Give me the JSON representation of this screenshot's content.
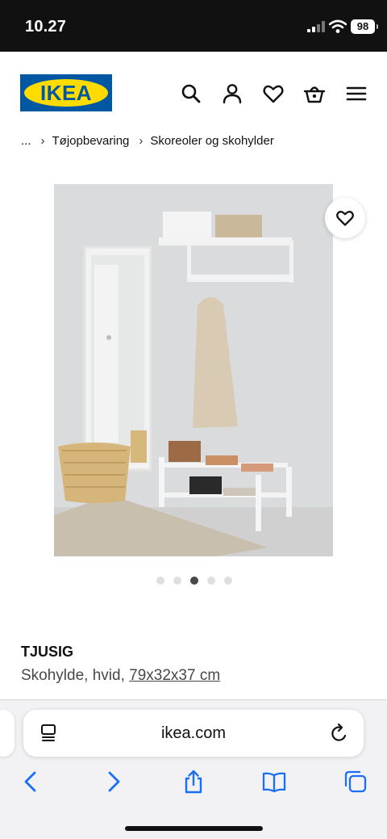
{
  "status_bar": {
    "time": "10.27",
    "battery": "98",
    "signal_icon": "cellular-signal-icon",
    "wifi_icon": "wifi-icon"
  },
  "header": {
    "logo_text": "IKEA",
    "colors": {
      "brand_blue": "#0058a3",
      "brand_yellow": "#ffdb00"
    },
    "icons": [
      "search-icon",
      "user-icon",
      "heart-icon",
      "basket-icon",
      "menu-icon"
    ]
  },
  "breadcrumb": {
    "ellipsis": "...",
    "items": [
      "Tøjopbevaring",
      "Skoreoler og skohylder"
    ]
  },
  "gallery": {
    "image_count": 5,
    "active_index": 2,
    "favorite_icon": "heart-icon"
  },
  "product": {
    "name": "TJUSIG",
    "description": "Skohylde, hvid, ",
    "dimensions": "79x32x37 cm"
  },
  "browser": {
    "address": "ikea.com",
    "toolbar_icons": [
      "back-icon",
      "forward-icon",
      "share-icon",
      "bookmarks-icon",
      "tabs-icon"
    ]
  }
}
